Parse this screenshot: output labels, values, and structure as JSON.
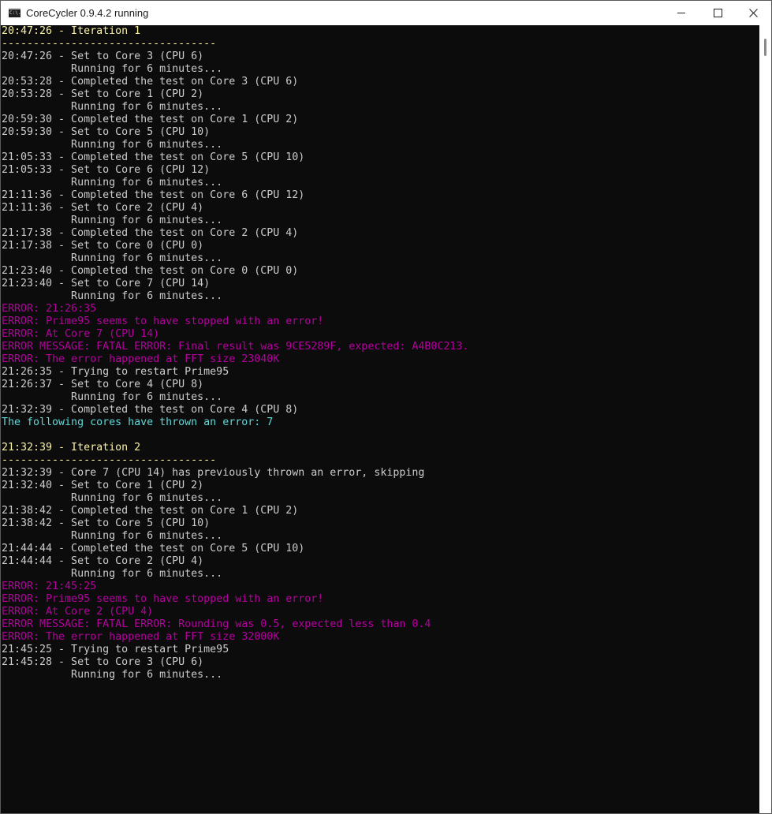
{
  "window": {
    "title": "CoreCycler 0.9.4.2 running",
    "icon_text": "C:\\.",
    "controls": {
      "minimize": "minimize-icon",
      "maximize": "maximize-icon",
      "close": "close-icon"
    }
  },
  "colors": {
    "background": "#0c0c0c",
    "default_text": "#cccccc",
    "header_text": "#f9f1a5",
    "error_text": "#b4009e",
    "info_text": "#61d6d6"
  },
  "console": {
    "lines": [
      {
        "text": "20:47:26 - Iteration 1",
        "style": "yellow"
      },
      {
        "text": "----------------------------------",
        "style": "yellow"
      },
      {
        "text": "20:47:26 - Set to Core 3 (CPU 6)",
        "style": "white"
      },
      {
        "text": "           Running for 6 minutes...",
        "style": "white"
      },
      {
        "text": "20:53:28 - Completed the test on Core 3 (CPU 6)",
        "style": "white"
      },
      {
        "text": "20:53:28 - Set to Core 1 (CPU 2)",
        "style": "white"
      },
      {
        "text": "           Running for 6 minutes...",
        "style": "white"
      },
      {
        "text": "20:59:30 - Completed the test on Core 1 (CPU 2)",
        "style": "white"
      },
      {
        "text": "20:59:30 - Set to Core 5 (CPU 10)",
        "style": "white"
      },
      {
        "text": "           Running for 6 minutes...",
        "style": "white"
      },
      {
        "text": "21:05:33 - Completed the test on Core 5 (CPU 10)",
        "style": "white"
      },
      {
        "text": "21:05:33 - Set to Core 6 (CPU 12)",
        "style": "white"
      },
      {
        "text": "           Running for 6 minutes...",
        "style": "white"
      },
      {
        "text": "21:11:36 - Completed the test on Core 6 (CPU 12)",
        "style": "white"
      },
      {
        "text": "21:11:36 - Set to Core 2 (CPU 4)",
        "style": "white"
      },
      {
        "text": "           Running for 6 minutes...",
        "style": "white"
      },
      {
        "text": "21:17:38 - Completed the test on Core 2 (CPU 4)",
        "style": "white"
      },
      {
        "text": "21:17:38 - Set to Core 0 (CPU 0)",
        "style": "white"
      },
      {
        "text": "           Running for 6 minutes...",
        "style": "white"
      },
      {
        "text": "21:23:40 - Completed the test on Core 0 (CPU 0)",
        "style": "white"
      },
      {
        "text": "21:23:40 - Set to Core 7 (CPU 14)",
        "style": "white"
      },
      {
        "text": "           Running for 6 minutes...",
        "style": "white"
      },
      {
        "text": "ERROR: 21:26:35",
        "style": "magenta"
      },
      {
        "text": "ERROR: Prime95 seems to have stopped with an error!",
        "style": "magenta"
      },
      {
        "text": "ERROR: At Core 7 (CPU 14)",
        "style": "magenta"
      },
      {
        "text": "ERROR MESSAGE: FATAL ERROR: Final result was 9CE5289F, expected: A4B0C213.",
        "style": "magenta"
      },
      {
        "text": "ERROR: The error happened at FFT size 23040K",
        "style": "magenta"
      },
      {
        "text": "21:26:35 - Trying to restart Prime95",
        "style": "white"
      },
      {
        "text": "21:26:37 - Set to Core 4 (CPU 8)",
        "style": "white"
      },
      {
        "text": "           Running for 6 minutes...",
        "style": "white"
      },
      {
        "text": "21:32:39 - Completed the test on Core 4 (CPU 8)",
        "style": "white"
      },
      {
        "text": "The following cores have thrown an error: 7",
        "style": "cyan"
      },
      {
        "text": "",
        "style": "white"
      },
      {
        "text": "21:32:39 - Iteration 2",
        "style": "yellow"
      },
      {
        "text": "----------------------------------",
        "style": "yellow"
      },
      {
        "text": "21:32:39 - Core 7 (CPU 14) has previously thrown an error, skipping",
        "style": "white"
      },
      {
        "text": "21:32:40 - Set to Core 1 (CPU 2)",
        "style": "white"
      },
      {
        "text": "           Running for 6 minutes...",
        "style": "white"
      },
      {
        "text": "21:38:42 - Completed the test on Core 1 (CPU 2)",
        "style": "white"
      },
      {
        "text": "21:38:42 - Set to Core 5 (CPU 10)",
        "style": "white"
      },
      {
        "text": "           Running for 6 minutes...",
        "style": "white"
      },
      {
        "text": "21:44:44 - Completed the test on Core 5 (CPU 10)",
        "style": "white"
      },
      {
        "text": "21:44:44 - Set to Core 2 (CPU 4)",
        "style": "white"
      },
      {
        "text": "           Running for 6 minutes...",
        "style": "white"
      },
      {
        "text": "ERROR: 21:45:25",
        "style": "magenta"
      },
      {
        "text": "ERROR: Prime95 seems to have stopped with an error!",
        "style": "magenta"
      },
      {
        "text": "ERROR: At Core 2 (CPU 4)",
        "style": "magenta"
      },
      {
        "text": "ERROR MESSAGE: FATAL ERROR: Rounding was 0.5, expected less than 0.4",
        "style": "magenta"
      },
      {
        "text": "ERROR: The error happened at FFT size 32000K",
        "style": "magenta"
      },
      {
        "text": "21:45:25 - Trying to restart Prime95",
        "style": "white"
      },
      {
        "text": "21:45:28 - Set to Core 3 (CPU 6)",
        "style": "white"
      },
      {
        "text": "           Running for 6 minutes...",
        "style": "white"
      }
    ]
  }
}
